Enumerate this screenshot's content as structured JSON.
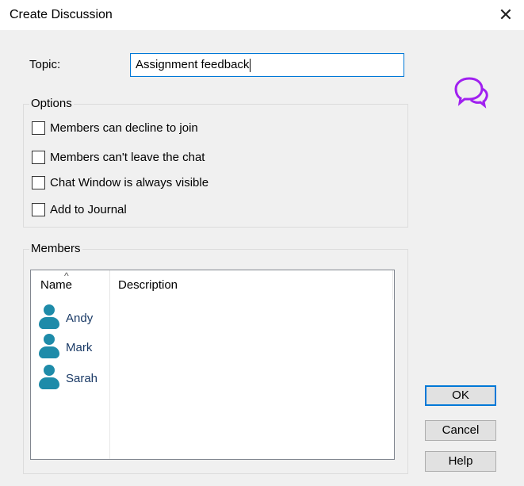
{
  "window": {
    "title": "Create Discussion",
    "close_glyph": "✕"
  },
  "topic": {
    "label": "Topic:",
    "value": "Assignment feedback"
  },
  "options": {
    "title": "Options",
    "items": [
      {
        "label": "Members can decline to join",
        "checked": false
      },
      {
        "label": "Members can't leave the chat",
        "checked": false
      },
      {
        "label": "Chat Window is always visible",
        "checked": false
      },
      {
        "label": "Add to Journal",
        "checked": false
      }
    ]
  },
  "members": {
    "title": "Members",
    "columns": {
      "name": "Name",
      "description": "Description",
      "sort_glyph": "^"
    },
    "rows": [
      {
        "name": "Andy",
        "description": "",
        "icon": "person-icon"
      },
      {
        "name": "Mark",
        "description": "",
        "icon": "person-icon"
      },
      {
        "name": "Sarah",
        "description": "",
        "icon": "person-icon"
      }
    ]
  },
  "buttons": {
    "ok": "OK",
    "cancel": "Cancel",
    "help": "Help"
  },
  "icons": {
    "chat": "chat-bubbles-icon",
    "chat_color": "#a020f0",
    "person_color": "#1e8ba9",
    "focus_color": "#0078d7"
  }
}
